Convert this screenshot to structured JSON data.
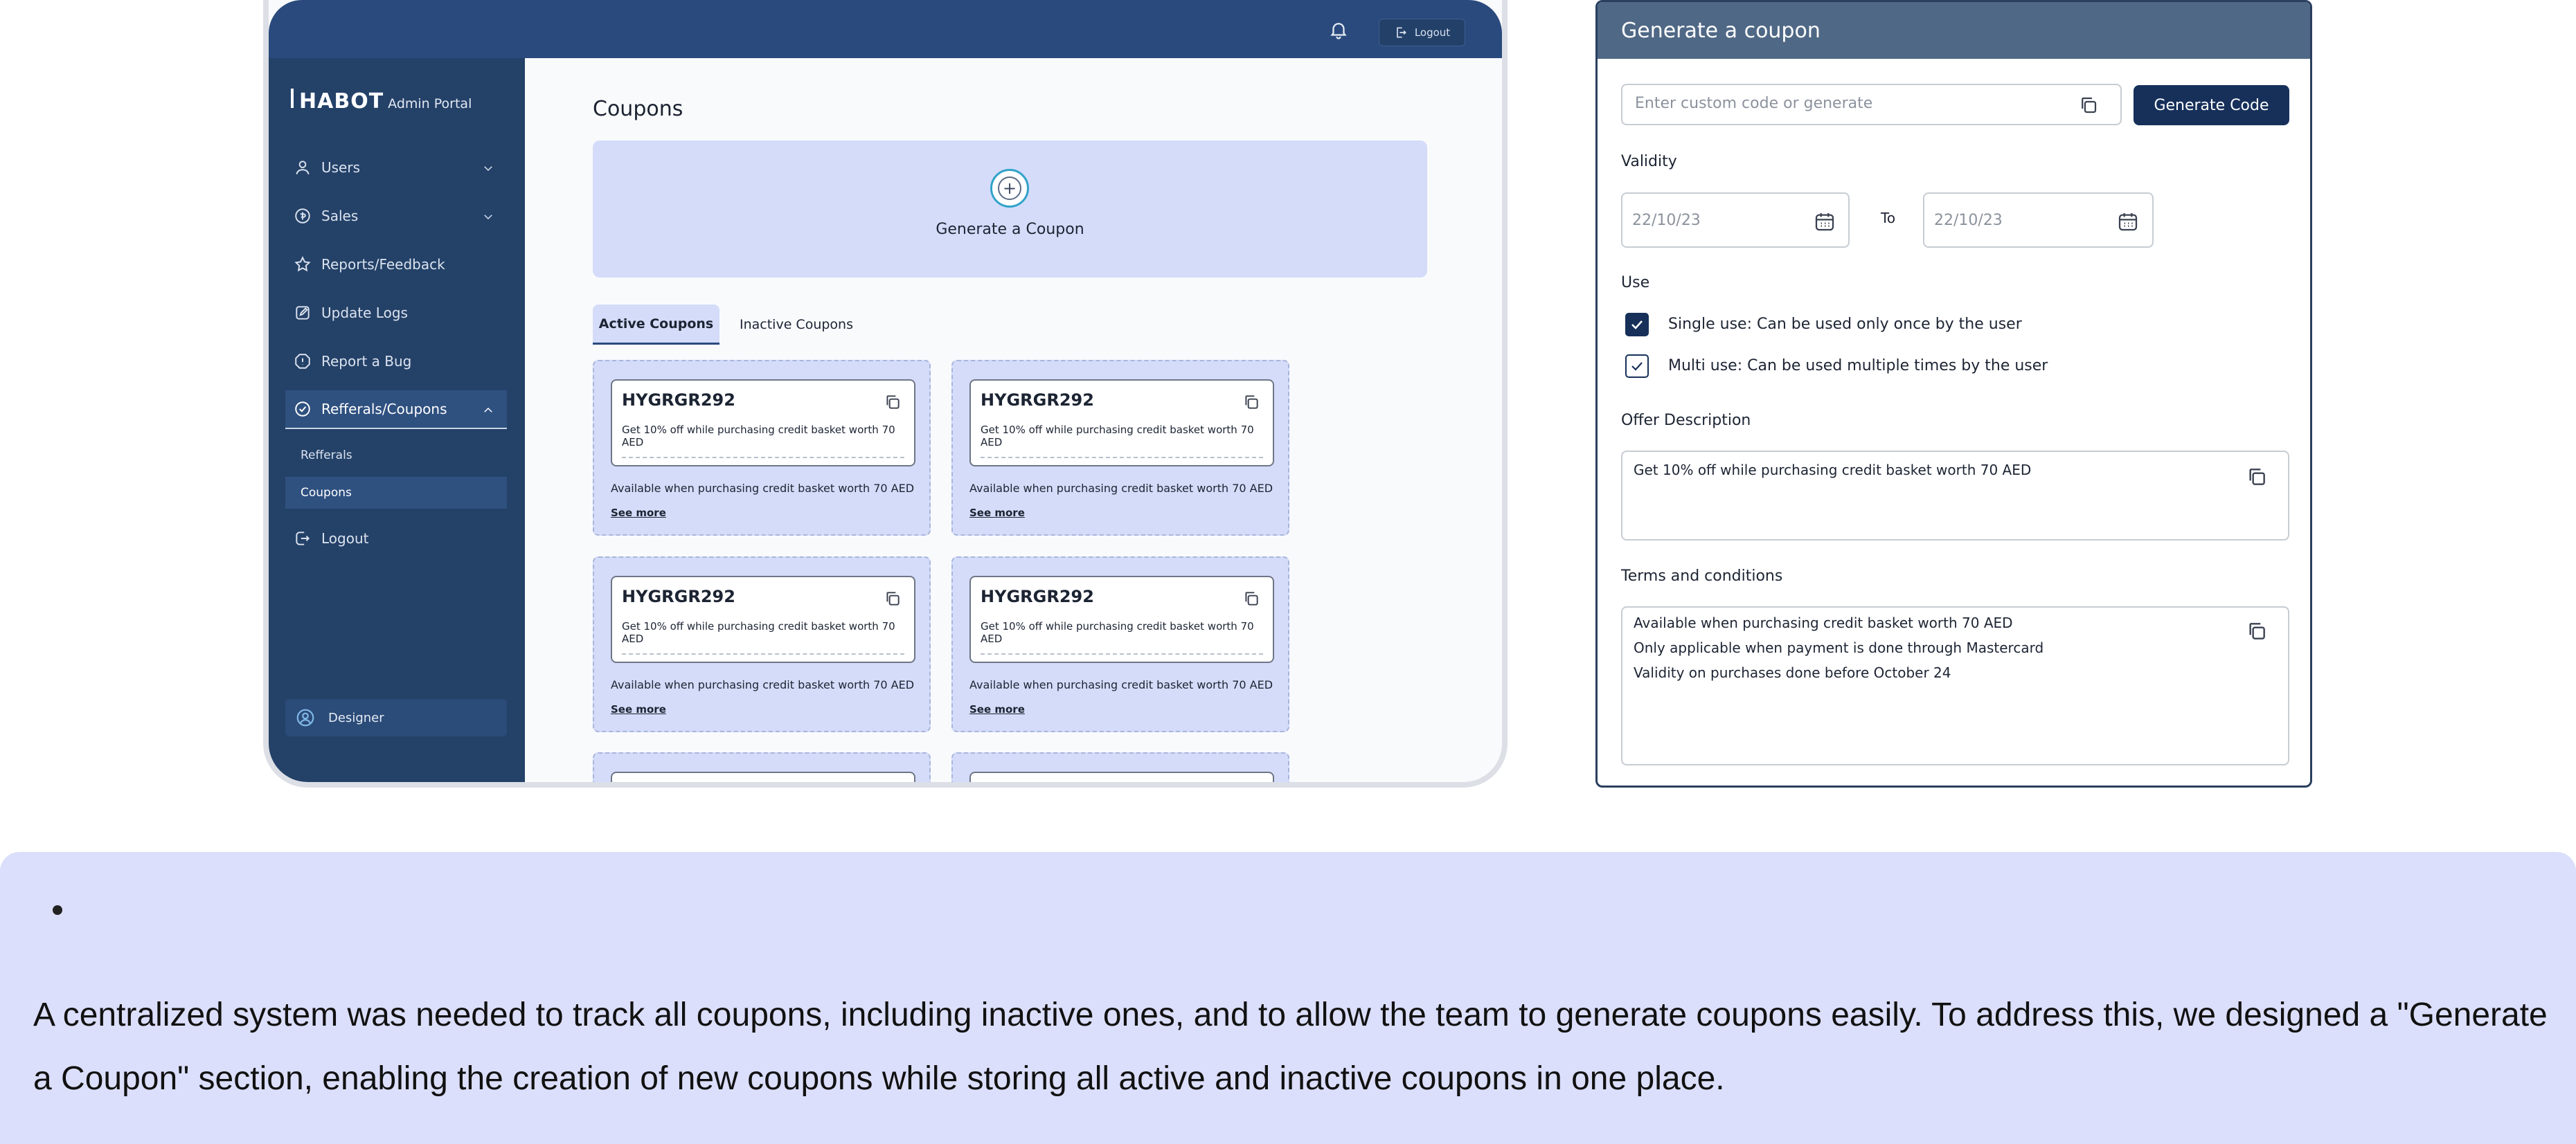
{
  "app": {
    "brand": "HABOT",
    "brand_sub": "Admin Portal",
    "logout_label": "Logout",
    "icons": [
      "bell-icon",
      "logout-icon"
    ]
  },
  "sidebar": {
    "items": [
      {
        "label": "Users",
        "icon": "user-icon",
        "expandable": true
      },
      {
        "label": "Sales",
        "icon": "sales-icon",
        "expandable": true
      },
      {
        "label": "Reports/Feedback",
        "icon": "star-icon",
        "expandable": false
      },
      {
        "label": "Update Logs",
        "icon": "edit-icon",
        "expandable": false
      },
      {
        "label": "Report a Bug",
        "icon": "alert-icon",
        "expandable": false
      },
      {
        "label": "Refferals/Coupons",
        "icon": "coupon-icon",
        "expandable": true,
        "active": true
      }
    ],
    "subitems": [
      {
        "label": "Refferals",
        "active": false
      },
      {
        "label": "Coupons",
        "active": true
      }
    ],
    "logout": "Logout",
    "designer": "Designer"
  },
  "main": {
    "title": "Coupons",
    "generate_label": "Generate a Coupon",
    "tabs": [
      {
        "label": "Active Coupons",
        "active": true
      },
      {
        "label": "Inactive Coupons",
        "active": false
      }
    ],
    "coupons": [
      {
        "code": "HYGRGR292",
        "description": "Get 10% off while purchasing credit basket worth 70 AED",
        "note": "Available when purchasing credit basket worth 70 AED",
        "link": "See more"
      },
      {
        "code": "HYGRGR292",
        "description": "Get 10% off while purchasing credit basket worth 70 AED",
        "note": "Available when purchasing credit basket worth 70 AED",
        "link": "See more"
      },
      {
        "code": "HYGRGR292",
        "description": "Get 10% off while purchasing credit basket worth 70 AED",
        "note": "Available when purchasing credit basket worth 70 AED",
        "link": "See more"
      },
      {
        "code": "HYGRGR292",
        "description": "Get 10% off while purchasing credit basket worth 70 AED",
        "note": "Available when purchasing credit basket worth 70 AED",
        "link": "See more"
      }
    ]
  },
  "panel": {
    "title": "Generate a coupon",
    "code_placeholder": "Enter custom code or generate",
    "generate_button": "Generate Code",
    "validity_label": "Validity",
    "date_from": "22/10/23",
    "to_label": "To",
    "date_to": "22/10/23",
    "use_label": "Use",
    "single_use": "Single use: Can be used only once by the user",
    "multi_use": "Multi use: Can be used multiple times by the user",
    "single_use_checked": true,
    "multi_use_checked": true,
    "offer_label": "Offer Description",
    "offer_text": "Get 10% off while purchasing credit basket worth 70 AED",
    "terms_label": "Terms and conditions",
    "terms": [
      "Available when purchasing credit basket worth 70 AED",
      "Only applicable when payment is done through Mastercard",
      "Validity on purchases done before October 24"
    ]
  },
  "caption": {
    "text": "A centralized system was needed to track all coupons, including inactive ones, and to allow the team to generate coupons easily. To address this, we designed a \"Generate a Coupon\" section, enabling the creation of new coupons while storing all active and inactive coupons in one place."
  },
  "colors": {
    "sidebar": "#244168",
    "topbar": "#2a4a7d",
    "accent_light": "#d4dcf9",
    "panel_header": "#4f6886",
    "primary_button": "#16305a",
    "caption_bg": "#dcdffb"
  }
}
